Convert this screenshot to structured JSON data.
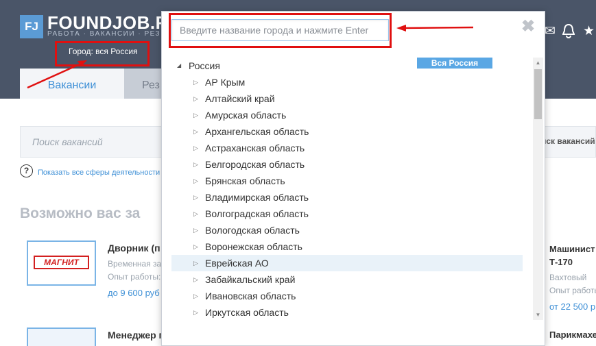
{
  "header": {
    "logo_mark": "FJ",
    "logo_text": "FOUNDJOB.R",
    "tagline": "РАБОТА · ВАКАНСИИ · РЕЗ",
    "city_label": "Город: вся Россия",
    "tabs": [
      {
        "label": "Вакансии",
        "active": true
      },
      {
        "label": "Рез",
        "active": false
      }
    ],
    "icons": [
      "mail-icon",
      "bell-icon",
      "star-icon"
    ]
  },
  "search": {
    "placeholder": "Поиск вакансий",
    "button_label": "иск вакансий"
  },
  "categories_link": "Показать все сферы деятельности",
  "help_icon_glyph": "?",
  "section_title": "Возможно вас за",
  "cards": {
    "left": [
      {
        "logo_text": "МАГНИТ",
        "title": "Дворник (п",
        "lines": [
          "Временная за",
          "Опыт работы:"
        ],
        "price": "до 9 600 руб"
      },
      {
        "title": "Менеджер п"
      }
    ],
    "right": [
      {
        "title_lines": [
          "Машинист",
          "Т-170"
        ],
        "lines": [
          "Вахтовый",
          "Опыт работы"
        ],
        "price": "от 22 500 р"
      },
      {
        "title": "Парикмахе"
      }
    ]
  },
  "city_modal": {
    "search_placeholder": "Введите название города и нажмите Enter",
    "close_glyph": "✖",
    "all_russia_button": "Вся Россия",
    "root": "Россия",
    "regions": [
      "АР Крым",
      "Алтайский край",
      "Амурская область",
      "Архангельская область",
      "Астраханская область",
      "Белгородская область",
      "Брянская область",
      "Владимирская область",
      "Волгоградская область",
      "Вологодская область",
      "Воронежская область",
      "Еврейская АО",
      "Забайкальский край",
      "Ивановская область",
      "Иркутская область"
    ],
    "highlighted_region": "Еврейская АО"
  },
  "colors": {
    "header_bg": "#4a5568",
    "accent": "#3d8fd6",
    "annotation": "#e01010",
    "highlight": "#e9f2f9"
  }
}
